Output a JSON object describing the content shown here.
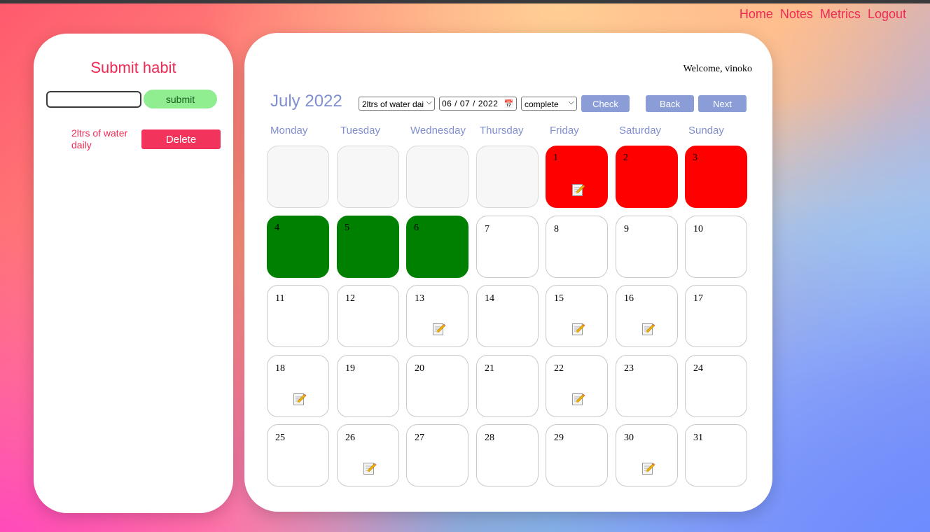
{
  "nav": {
    "home": "Home",
    "notes": "Notes",
    "metrics": "Metrics",
    "logout": "Logout"
  },
  "sidebar": {
    "title": "Submit habit",
    "input_value": "",
    "submit_label": "submit",
    "habits": [
      {
        "name": "2ltrs of water daily",
        "delete_label": "Delete"
      }
    ]
  },
  "calendar": {
    "welcome": "Welcome, vinoko",
    "month_title": "July 2022",
    "habit_select": "2ltrs of water dai",
    "date_value": "06 / 07 / 2022",
    "status_select": "complete",
    "check_label": "Check",
    "back_label": "Back",
    "next_label": "Next",
    "weekdays": [
      "Monday",
      "Tuesday",
      "Wednesday",
      "Thursday",
      "Friday",
      "Saturday",
      "Sunday"
    ],
    "leading_blanks": 4,
    "days": [
      {
        "day": "1",
        "status": "red",
        "note": true
      },
      {
        "day": "2",
        "status": "red",
        "note": false
      },
      {
        "day": "3",
        "status": "red",
        "note": false
      },
      {
        "day": "4",
        "status": "green",
        "note": false
      },
      {
        "day": "5",
        "status": "green",
        "note": false
      },
      {
        "day": "6",
        "status": "green",
        "note": false
      },
      {
        "day": "7",
        "status": "none",
        "note": false
      },
      {
        "day": "8",
        "status": "none",
        "note": false
      },
      {
        "day": "9",
        "status": "none",
        "note": false
      },
      {
        "day": "10",
        "status": "none",
        "note": false
      },
      {
        "day": "11",
        "status": "none",
        "note": false
      },
      {
        "day": "12",
        "status": "none",
        "note": false
      },
      {
        "day": "13",
        "status": "none",
        "note": true
      },
      {
        "day": "14",
        "status": "none",
        "note": false
      },
      {
        "day": "15",
        "status": "none",
        "note": true
      },
      {
        "day": "16",
        "status": "none",
        "note": true
      },
      {
        "day": "17",
        "status": "none",
        "note": false
      },
      {
        "day": "18",
        "status": "none",
        "note": true
      },
      {
        "day": "19",
        "status": "none",
        "note": false
      },
      {
        "day": "20",
        "status": "none",
        "note": false
      },
      {
        "day": "21",
        "status": "none",
        "note": false
      },
      {
        "day": "22",
        "status": "none",
        "note": true
      },
      {
        "day": "23",
        "status": "none",
        "note": false
      },
      {
        "day": "24",
        "status": "none",
        "note": false
      },
      {
        "day": "25",
        "status": "none",
        "note": false
      },
      {
        "day": "26",
        "status": "none",
        "note": true
      },
      {
        "day": "27",
        "status": "none",
        "note": false
      },
      {
        "day": "28",
        "status": "none",
        "note": false
      },
      {
        "day": "29",
        "status": "none",
        "note": false
      },
      {
        "day": "30",
        "status": "none",
        "note": true
      },
      {
        "day": "31",
        "status": "none",
        "note": false
      }
    ],
    "colors": {
      "missed": "#ff0000",
      "complete": "#008000",
      "accent": "#7f8fd0",
      "brand": "#ef2a55"
    },
    "note_icon": "note-pencil-icon"
  }
}
